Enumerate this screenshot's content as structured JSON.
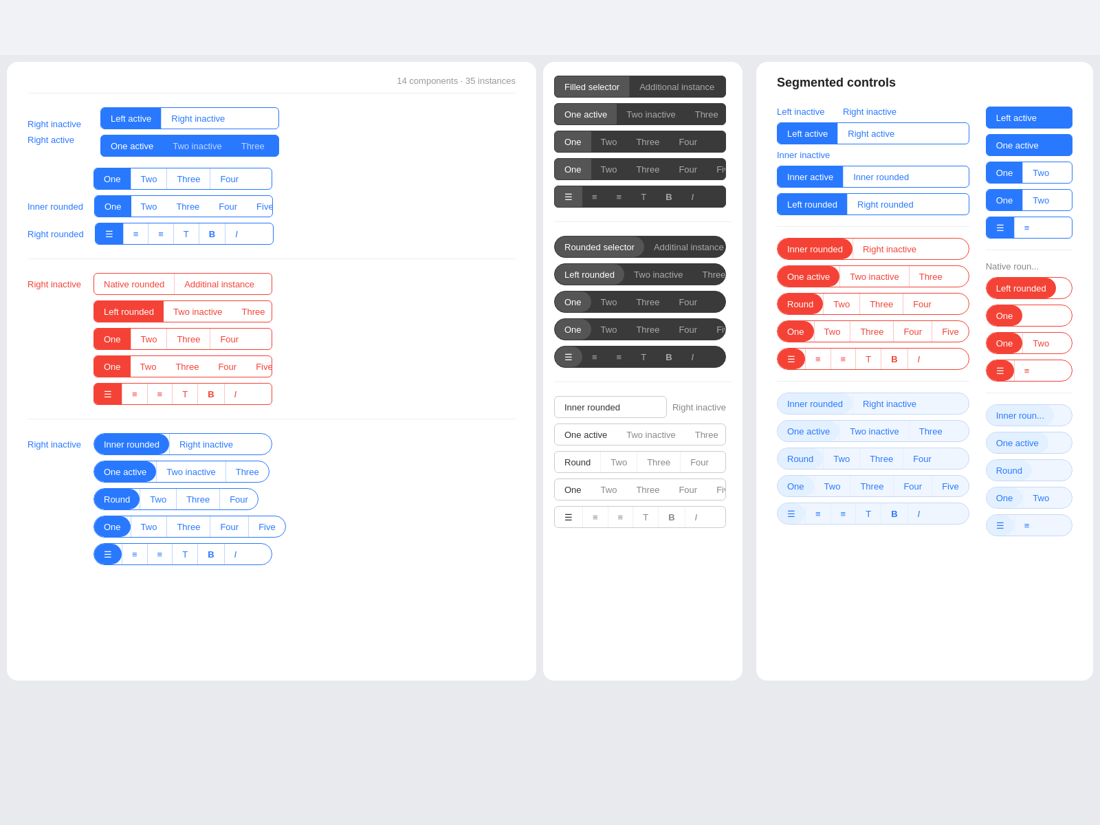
{
  "header": {
    "stats": "14 components · 35 instances"
  },
  "rightCard": {
    "title": "Segmented controls"
  },
  "segments": {
    "blue": "#2979ff",
    "red": "#f44336",
    "dark": "#3d3d3d",
    "gray": "#999"
  }
}
